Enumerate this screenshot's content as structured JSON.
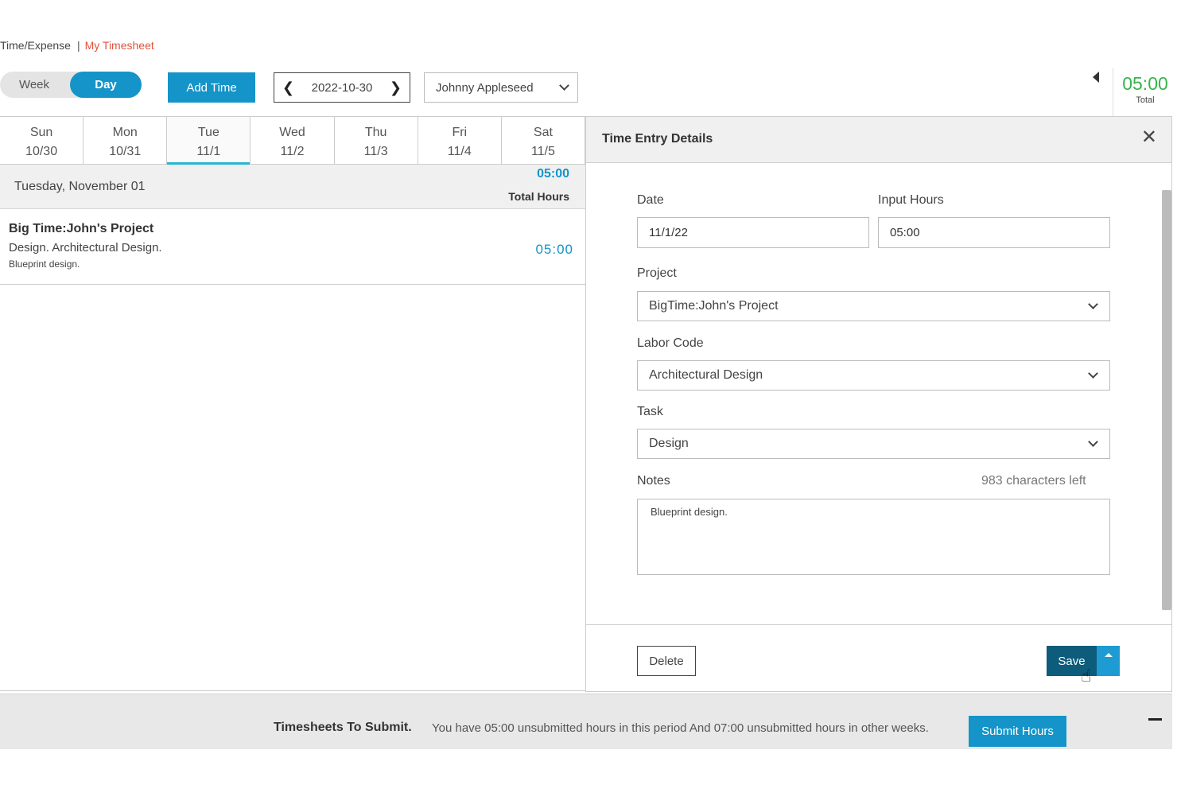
{
  "breadcrumb": {
    "parent": "Time/Expense",
    "separator": "|",
    "current": "My Timesheet"
  },
  "view_toggle": {
    "week": "Week",
    "day": "Day",
    "selected": "Day"
  },
  "toolbar": {
    "add_time": "Add Time",
    "date_prev": "❮",
    "date": "2022-10-30",
    "date_next": "❯",
    "user": "Johnny Appleseed"
  },
  "summary": {
    "total_value": "05:00",
    "total_label": "Total"
  },
  "days": [
    {
      "name": "Sun",
      "date": "10/30"
    },
    {
      "name": "Mon",
      "date": "10/31"
    },
    {
      "name": "Tue",
      "date": "11/1",
      "active": true
    },
    {
      "name": "Wed",
      "date": "11/2"
    },
    {
      "name": "Thu",
      "date": "11/3"
    },
    {
      "name": "Fri",
      "date": "11/4"
    },
    {
      "name": "Sat",
      "date": "11/5"
    }
  ],
  "day_summary": {
    "date": "Tuesday, November 01",
    "hours": "05:00",
    "hours_label": "Total Hours"
  },
  "entry": {
    "project": "Big Time:John's Project",
    "description": "Design. Architectural Design.",
    "note": "Blueprint design.",
    "hours": "05:00"
  },
  "panel": {
    "title": "Time Entry Details",
    "close": "✕",
    "date_label": "Date",
    "date_value": "11/1/22",
    "hours_label": "Input Hours",
    "hours_value": "05:00",
    "project_label": "Project",
    "project_value": "BigTime:John's Project",
    "labor_label": "Labor Code",
    "labor_value": "Architectural Design",
    "task_label": "Task",
    "task_value": "Design",
    "notes_label": "Notes",
    "notes_chars_left": "983 characters left",
    "notes_value": "Blueprint design.",
    "delete": "Delete",
    "save": "Save"
  },
  "submit_bar": {
    "label": "Timesheets To Submit.",
    "message": "You have 05:00 unsubmitted hours in this period And 07:00 unsubmitted hours in other weeks.",
    "button": "Submit Hours"
  },
  "colors": {
    "accent": "#1494c9",
    "save": "#0d5c7c",
    "total_green": "#38b44a",
    "breadcrumb_current": "#e0533e"
  }
}
